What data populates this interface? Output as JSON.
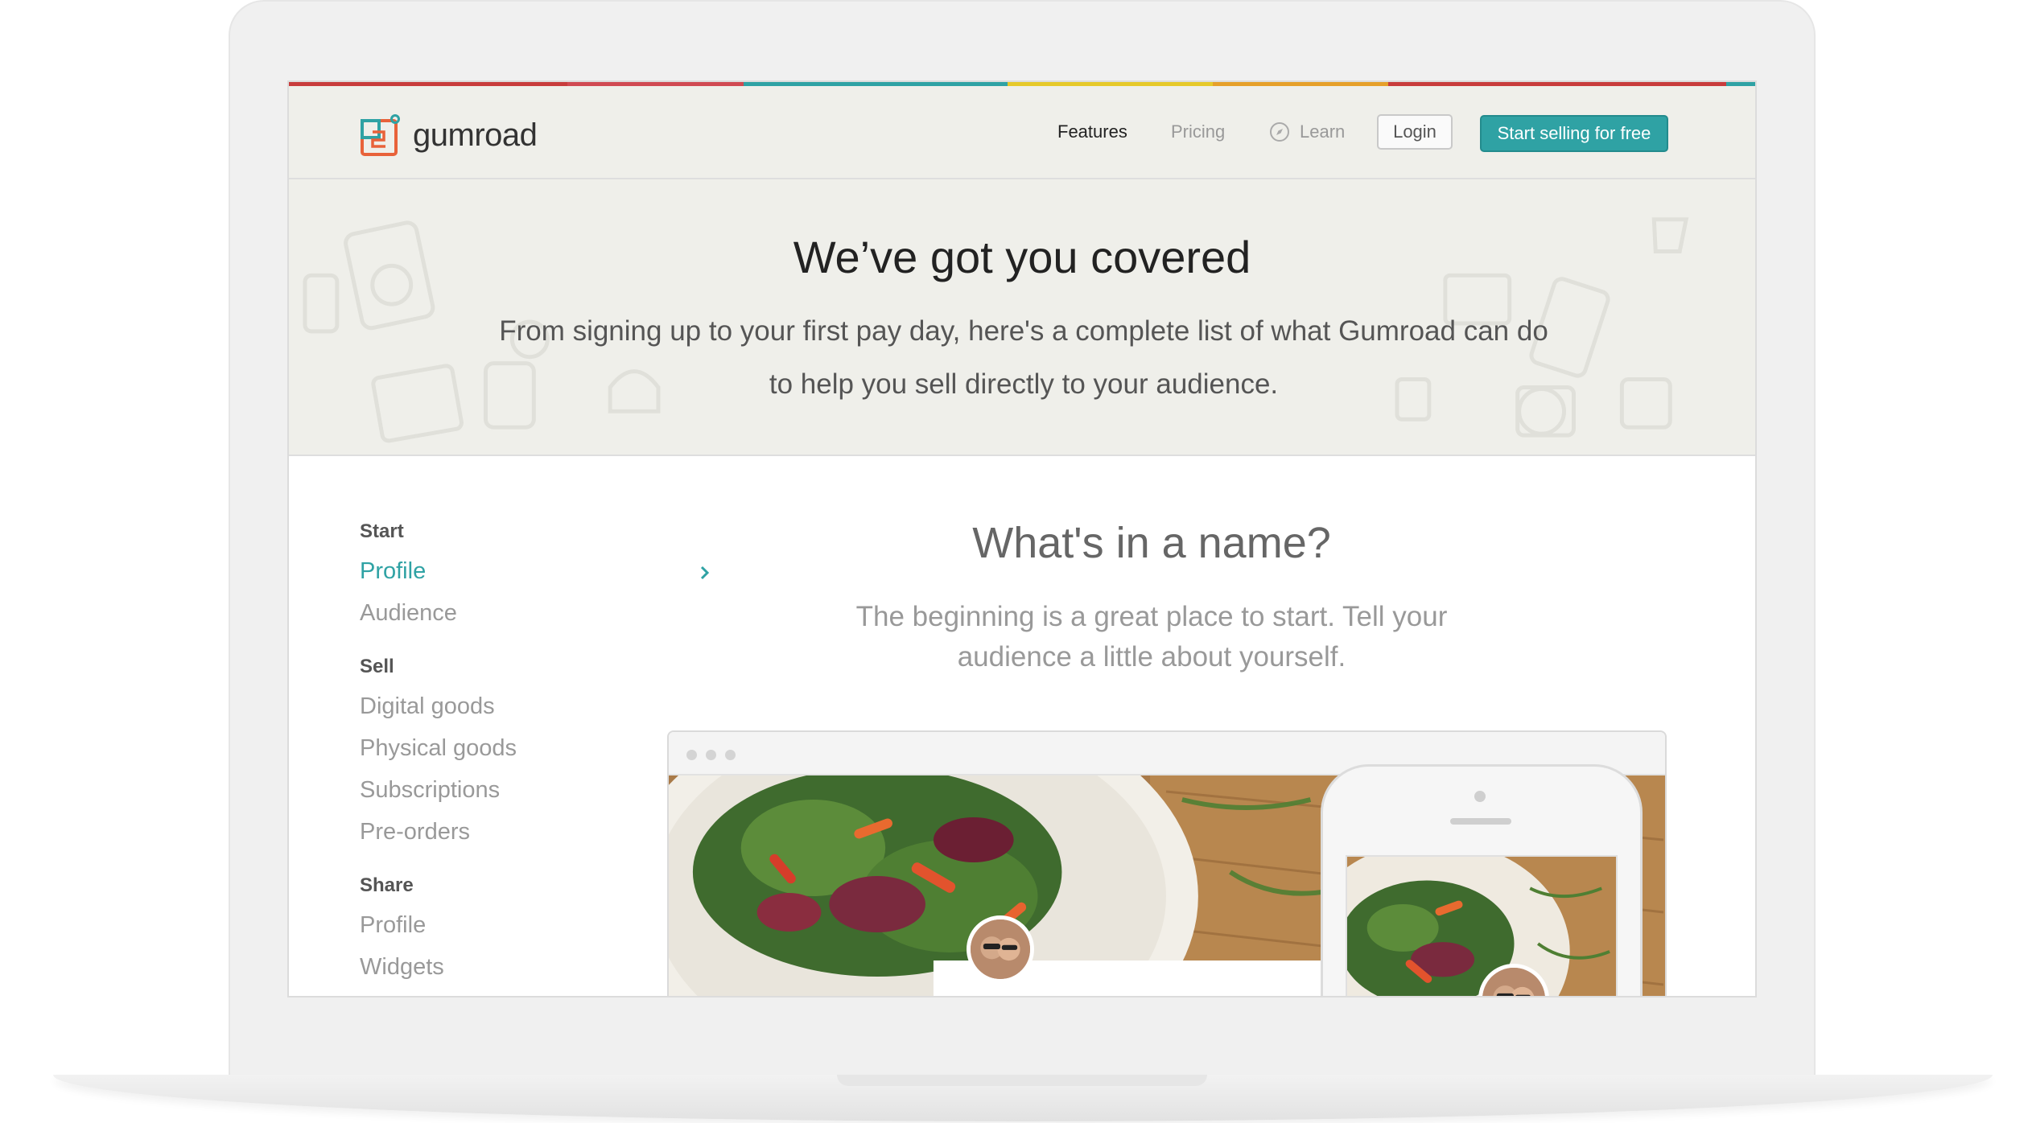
{
  "colors": {
    "accent": "#2fa2a4",
    "stripe": [
      "#c83c3c",
      "#e6a02a",
      "#2fa2a4",
      "#e6c92a",
      "#d04a52",
      "#2fa2a4"
    ]
  },
  "nav": {
    "logo_text": "gumroad",
    "features": "Features",
    "pricing": "Pricing",
    "learn": "Learn",
    "login": "Login",
    "cta": "Start selling for free"
  },
  "hero": {
    "title": "We’ve got you covered",
    "subtitle": "From signing up to your first pay day, here's a complete list of what Gumroad can do to help you sell directly to your audience."
  },
  "sidebar": {
    "groups": [
      {
        "heading": "Start",
        "items": [
          "Profile",
          "Audience"
        ]
      },
      {
        "heading": "Sell",
        "items": [
          "Digital goods",
          "Physical goods",
          "Subscriptions",
          "Pre-orders"
        ]
      },
      {
        "heading": "Share",
        "items": [
          "Profile",
          "Widgets"
        ]
      }
    ],
    "active": "Profile"
  },
  "section": {
    "title": "What's in a name?",
    "description": "The beginning is a great place to start. Tell your audience a little about yourself."
  },
  "icons": [
    "logo-icon",
    "compass-icon",
    "chevron-right-icon"
  ]
}
